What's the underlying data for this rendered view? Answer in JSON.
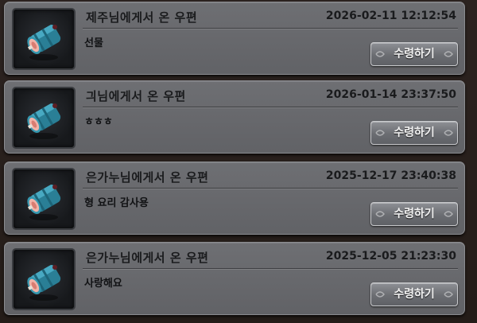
{
  "mails": [
    {
      "sender": "제주님에게서 온 우편",
      "date": "2026-02-11 12:12:54",
      "message": "선물",
      "button_label": "수령하기",
      "item_icon": "cake-roll-icon"
    },
    {
      "sender": "긔님에게서 온 우편",
      "date": "2026-01-14 23:37:50",
      "message": "ㅎㅎㅎ",
      "button_label": "수령하기",
      "item_icon": "cake-roll-icon"
    },
    {
      "sender": "은가누님에게서 온 우편",
      "date": "2025-12-17 23:40:38",
      "message": "형 요리 감사용",
      "button_label": "수령하기",
      "item_icon": "cake-roll-icon"
    },
    {
      "sender": "은가누님에게서 온 우편",
      "date": "2025-12-05 21:23:30",
      "message": "사랑해요",
      "button_label": "수령하기",
      "item_icon": "cake-roll-icon"
    }
  ],
  "colors": {
    "card_bg": "#666769",
    "item_teal": "#2f8fa6",
    "item_pink": "#e8a59c",
    "button_border": "#c8c9cc"
  }
}
